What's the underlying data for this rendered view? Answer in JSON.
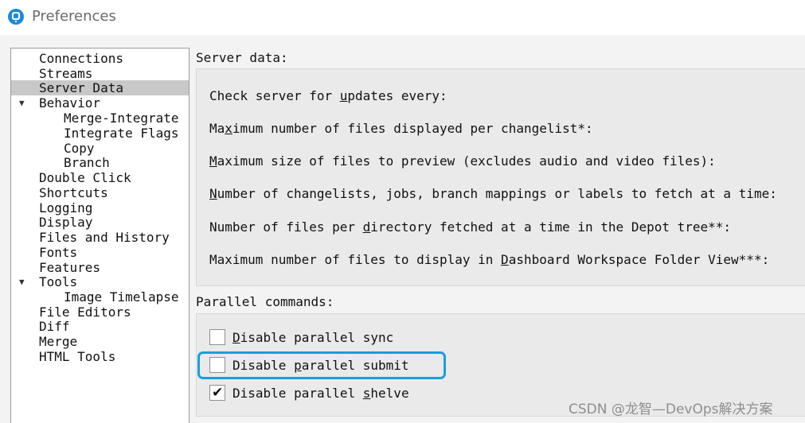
{
  "window": {
    "title": "Preferences"
  },
  "nav": {
    "items": [
      {
        "label": "Connections",
        "expander": ""
      },
      {
        "label": "Streams",
        "expander": ""
      },
      {
        "label": "Server Data",
        "expander": "",
        "selected": true
      },
      {
        "label": "Behavior",
        "expander": "▼"
      },
      {
        "label": "Merge-Integrate",
        "expander": ""
      },
      {
        "label": "Integrate Flags",
        "expander": ""
      },
      {
        "label": "Copy",
        "expander": ""
      },
      {
        "label": "Branch",
        "expander": ""
      },
      {
        "label": "Double Click",
        "expander": ""
      },
      {
        "label": "Shortcuts",
        "expander": ""
      },
      {
        "label": "Logging",
        "expander": ""
      },
      {
        "label": "Display",
        "expander": ""
      },
      {
        "label": "Files and History",
        "expander": ""
      },
      {
        "label": "Fonts",
        "expander": ""
      },
      {
        "label": "Features",
        "expander": ""
      },
      {
        "label": "Tools",
        "expander": "▼"
      },
      {
        "label": "Image Timelapse",
        "expander": ""
      },
      {
        "label": "File Editors",
        "expander": ""
      },
      {
        "label": "Diff",
        "expander": ""
      },
      {
        "label": "Merge",
        "expander": ""
      },
      {
        "label": "HTML Tools",
        "expander": ""
      }
    ]
  },
  "server_data": {
    "section_title": "Server data:",
    "settings": [
      {
        "pre": "Check server for ",
        "key": "u",
        "post": "pdates every:"
      },
      {
        "pre": "Ma",
        "key": "x",
        "post": "imum number of files displayed per changelist*:"
      },
      {
        "pre": "",
        "key": "M",
        "post": "aximum size of files to preview (excludes audio and video files):"
      },
      {
        "pre": "",
        "key": "N",
        "post": "umber of changelists, jobs, branch mappings or labels to fetch at a time:"
      },
      {
        "pre": "Number of files per ",
        "key": "d",
        "post": "irectory fetched at a time in the Depot tree**:"
      },
      {
        "pre": "Maximum number of files to display in ",
        "key": "D",
        "post": "ashboard Workspace Folder View***:"
      }
    ]
  },
  "parallel_commands": {
    "section_title": "Parallel commands:",
    "options": [
      {
        "pre": "",
        "key": "D",
        "post": "isable parallel sync",
        "checked": false
      },
      {
        "pre": "Disable ",
        "key": "p",
        "post": "arallel submit",
        "checked": false
      },
      {
        "pre": "Disable parallel ",
        "key": "s",
        "post": "helve",
        "checked": true
      }
    ]
  },
  "check_glyph": "✔",
  "watermark": "CSDN @龙智—DevOps解决方案",
  "colors": {
    "highlight": "#1a9fd9",
    "selection": "#c8c8c8",
    "app_icon": "#1d8ad6"
  }
}
